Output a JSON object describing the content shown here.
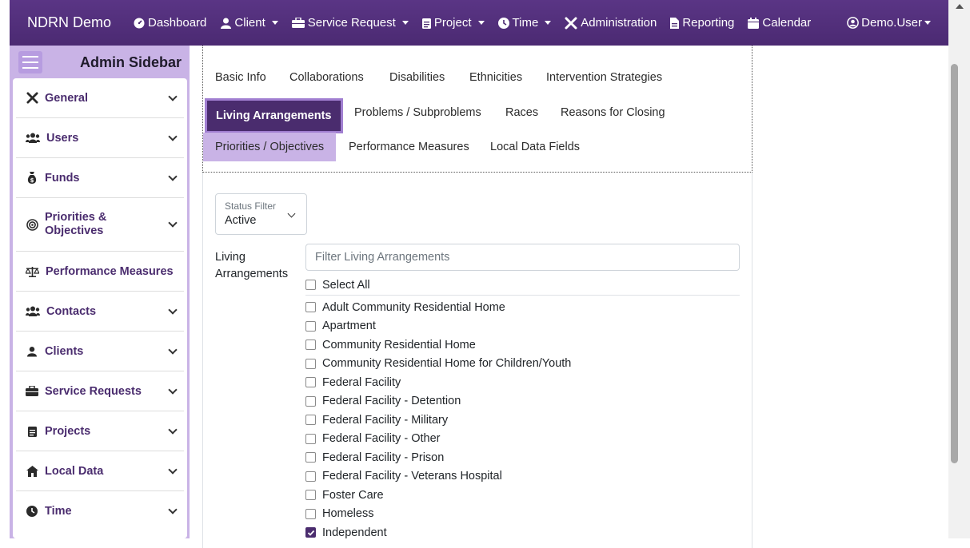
{
  "navbar": {
    "brand": "NDRN Demo",
    "items": [
      {
        "label": "Dashboard",
        "icon": "dashboard-icon",
        "dropdown": false
      },
      {
        "label": "Client",
        "icon": "user-icon",
        "dropdown": true
      },
      {
        "label": "Service Request",
        "icon": "briefcase-icon",
        "dropdown": true
      },
      {
        "label": "Project",
        "icon": "clipboard-icon",
        "dropdown": true
      },
      {
        "label": "Time",
        "icon": "clock-icon",
        "dropdown": true
      },
      {
        "label": "Administration",
        "icon": "tools-icon",
        "dropdown": false
      },
      {
        "label": "Reporting",
        "icon": "file-icon",
        "dropdown": false
      },
      {
        "label": "Calendar",
        "icon": "calendar-icon",
        "dropdown": false
      }
    ],
    "user": "Demo.User"
  },
  "sidebar": {
    "title": "Admin Sidebar",
    "items": [
      {
        "label": "General",
        "icon": "tools-icon",
        "expandable": true
      },
      {
        "label": "Users",
        "icon": "users-icon",
        "expandable": true
      },
      {
        "label": "Funds",
        "icon": "money-bag-icon",
        "expandable": true
      },
      {
        "label": "Priorities & Objectives",
        "icon": "target-icon",
        "expandable": true
      },
      {
        "label": "Performance Measures",
        "icon": "scale-icon",
        "expandable": false
      },
      {
        "label": "Contacts",
        "icon": "users-icon",
        "expandable": true
      },
      {
        "label": "Clients",
        "icon": "user-icon",
        "expandable": true
      },
      {
        "label": "Service Requests",
        "icon": "briefcase-icon",
        "expandable": true
      },
      {
        "label": "Projects",
        "icon": "clipboard-icon",
        "expandable": true
      },
      {
        "label": "Local Data",
        "icon": "house-icon",
        "expandable": true
      },
      {
        "label": "Time",
        "icon": "clock-icon",
        "expandable": true
      }
    ]
  },
  "tabs": {
    "basic_info": "Basic Info",
    "collaborations": "Collaborations",
    "disabilities": "Disabilities",
    "ethnicities": "Ethnicities",
    "intervention_strategies": "Intervention Strategies",
    "living_arrangements": "Living Arrangements",
    "problems": "Problems / Subproblems",
    "races": "Races",
    "reasons_for_closing": "Reasons for Closing",
    "priorities": "Priorities / Objectives",
    "performance_measures": "Performance Measures",
    "local_data_fields": "Local Data Fields"
  },
  "status_filter": {
    "label": "Status Filter",
    "value": "Active"
  },
  "living_arrangements": {
    "label": "Living Arrangements",
    "filter_placeholder": "Filter Living Arrangements",
    "select_all": "Select All",
    "options": [
      {
        "label": "Adult Community Residential Home",
        "checked": false
      },
      {
        "label": "Apartment",
        "checked": false
      },
      {
        "label": "Community Residential Home",
        "checked": false
      },
      {
        "label": "Community Residential Home for Children/Youth",
        "checked": false
      },
      {
        "label": "Federal Facility",
        "checked": false
      },
      {
        "label": "Federal Facility - Detention",
        "checked": false
      },
      {
        "label": "Federal Facility - Military",
        "checked": false
      },
      {
        "label": "Federal Facility - Other",
        "checked": false
      },
      {
        "label": "Federal Facility - Prison",
        "checked": false
      },
      {
        "label": "Federal Facility - Veterans Hospital",
        "checked": false
      },
      {
        "label": "Foster Care",
        "checked": false
      },
      {
        "label": "Homeless",
        "checked": false
      },
      {
        "label": "Independent",
        "checked": true
      }
    ]
  },
  "colors": {
    "primary": "#4a2c6e",
    "sidebar_bg": "#c9b3e6",
    "navbar": "#5a3585"
  }
}
